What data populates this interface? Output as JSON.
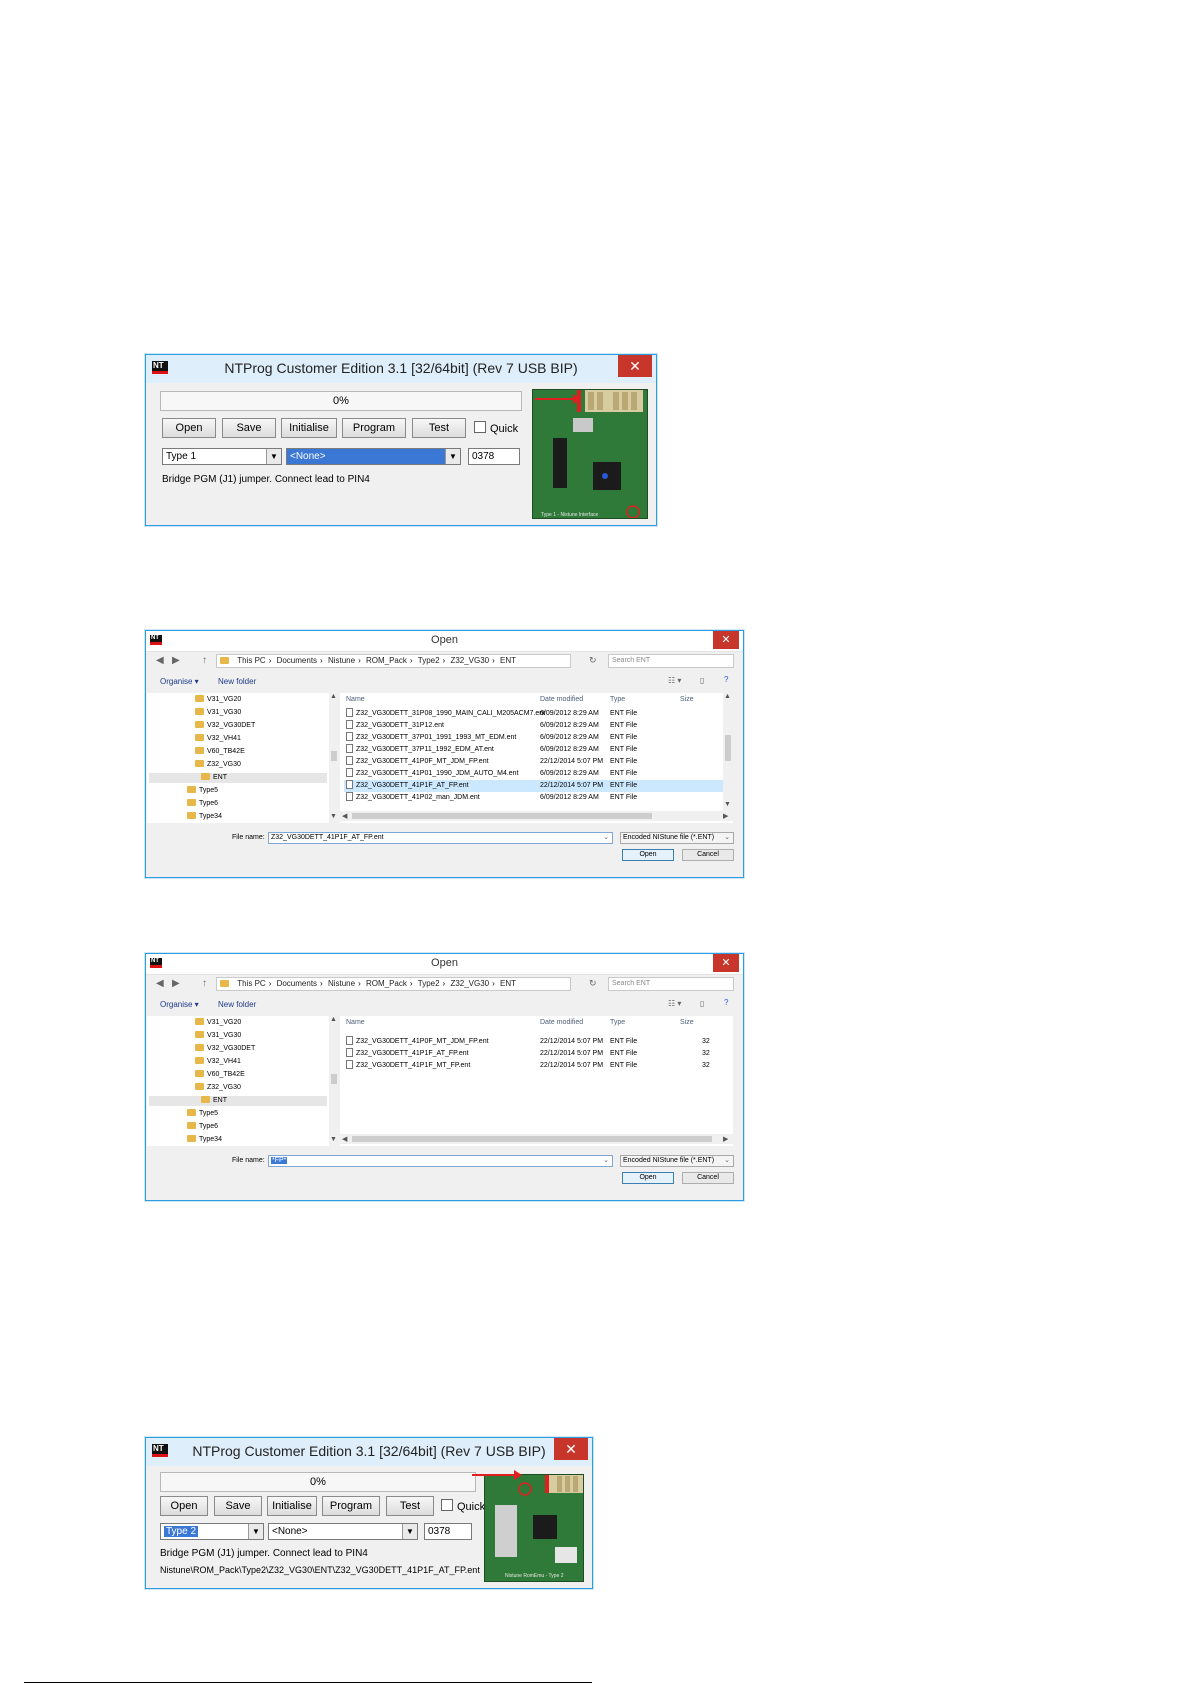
{
  "colors": {
    "window_border": "#2b9de0",
    "close_red": "#c7352b",
    "selection_blue": "#3b78d6",
    "pcb_green": "#2f7a38",
    "arrow_red": "#e02020"
  },
  "ntprog1": {
    "title": "NTProg Customer Edition 3.1 [32/64bit]  (Rev 7 USB BIP)",
    "close": "✕",
    "progress": 0.0,
    "progress_text": "0%",
    "buttons": {
      "open": "Open",
      "save": "Save",
      "initialise": "Initialise",
      "program": "Program",
      "test": "Test"
    },
    "quick_label": "Quick",
    "type_value": "Type 1",
    "rom_value": "<None>",
    "address_value": "0378",
    "hint": "Bridge PGM (J1) jumper. Connect lead to PIN4",
    "pcb_label": "Type 1 - Nistune Interface"
  },
  "open1": {
    "title": "Open",
    "close": "✕",
    "path": [
      "This PC",
      "Documents",
      "Nistune",
      "ROM_Pack",
      "Type2",
      "Z32_VG30",
      "ENT"
    ],
    "search_placeholder": "Search ENT",
    "organise": "Organise ▾",
    "new_folder": "New folder",
    "tree": [
      "V31_VG20",
      "V31_VG30",
      "V32_VG30DET",
      "V32_VH41",
      "V60_TB42E",
      "Z32_VG30",
      "ENT",
      "Type5",
      "Type6",
      "Type34"
    ],
    "columns": {
      "name": "Name",
      "date": "Date modified",
      "type": "Type",
      "size": "Size"
    },
    "files": [
      {
        "name": "Z32_VG30DETT_31P08_1990_MAIN_CALI_M205ACM7.ent",
        "date": "6/09/2012 8:29 AM",
        "type": "ENT File"
      },
      {
        "name": "Z32_VG30DETT_31P12.ent",
        "date": "6/09/2012 8:29 AM",
        "type": "ENT File"
      },
      {
        "name": "Z32_VG30DETT_37P01_1991_1993_MT_EDM.ent",
        "date": "6/09/2012 8:29 AM",
        "type": "ENT File"
      },
      {
        "name": "Z32_VG30DETT_37P11_1992_EDM_AT.ent",
        "date": "6/09/2012 8:29 AM",
        "type": "ENT File"
      },
      {
        "name": "Z32_VG30DETT_41P0F_MT_JDM_FP.ent",
        "date": "22/12/2014 5:07 PM",
        "type": "ENT File"
      },
      {
        "name": "Z32_VG30DETT_41P01_1990_JDM_AUTO_M4.ent",
        "date": "6/09/2012 8:29 AM",
        "type": "ENT File"
      },
      {
        "name": "Z32_VG30DETT_41P1F_AT_FP.ent",
        "date": "22/12/2014 5:07 PM",
        "type": "ENT File"
      },
      {
        "name": "Z32_VG30DETT_41P02_man_JDM.ent",
        "date": "6/09/2012 8:29 AM",
        "type": "ENT File"
      }
    ],
    "filename_label": "File name:",
    "filename_value": "Z32_VG30DETT_41P1F_AT_FP.ent",
    "filetype": "Encoded NIStune file (*.ENT)",
    "open_btn": "Open",
    "cancel_btn": "Cancel"
  },
  "open2": {
    "title": "Open",
    "close": "✕",
    "path": [
      "This PC",
      "Documents",
      "Nistune",
      "ROM_Pack",
      "Type2",
      "Z32_VG30",
      "ENT"
    ],
    "search_placeholder": "Search ENT",
    "organise": "Organise ▾",
    "new_folder": "New folder",
    "tree": [
      "V31_VG20",
      "V31_VG30",
      "V32_VG30DET",
      "V32_VH41",
      "V60_TB42E",
      "Z32_VG30",
      "ENT",
      "Type5",
      "Type6",
      "Type34"
    ],
    "columns": {
      "name": "Name",
      "date": "Date modified",
      "type": "Type",
      "size": "Size"
    },
    "files": [
      {
        "name": "Z32_VG30DETT_41P0F_MT_JDM_FP.ent",
        "date": "22/12/2014 5:07 PM",
        "type": "ENT File",
        "size": "32"
      },
      {
        "name": "Z32_VG30DETT_41P1F_AT_FP.ent",
        "date": "22/12/2014 5:07 PM",
        "type": "ENT File",
        "size": "32"
      },
      {
        "name": "Z32_VG30DETT_41P1F_MT_FP.ent",
        "date": "22/12/2014 5:07 PM",
        "type": "ENT File",
        "size": "32"
      }
    ],
    "filename_label": "File name:",
    "filename_value": "*FP*",
    "filetype": "Encoded NIStune file (*.ENT)",
    "open_btn": "Open",
    "cancel_btn": "Cancel"
  },
  "ntprog2": {
    "title": "NTProg Customer Edition 3.1 [32/64bit]  (Rev 7 USB BIP)",
    "close": "✕",
    "progress": 0.0,
    "progress_text": "0%",
    "buttons": {
      "open": "Open",
      "save": "Save",
      "initialise": "Initialise",
      "program": "Program",
      "test": "Test"
    },
    "quick_label": "Quick",
    "type_value": "Type 2",
    "rom_value": "<None>",
    "address_value": "0378",
    "hint": "Bridge PGM (J1) jumper. Connect lead to PIN4",
    "path": "Nistune\\ROM_Pack\\Type2\\Z32_VG30\\ENT\\Z32_VG30DETT_41P1F_AT_FP.ent",
    "pcb_label": "Nistune RomEmu - Type 2"
  }
}
